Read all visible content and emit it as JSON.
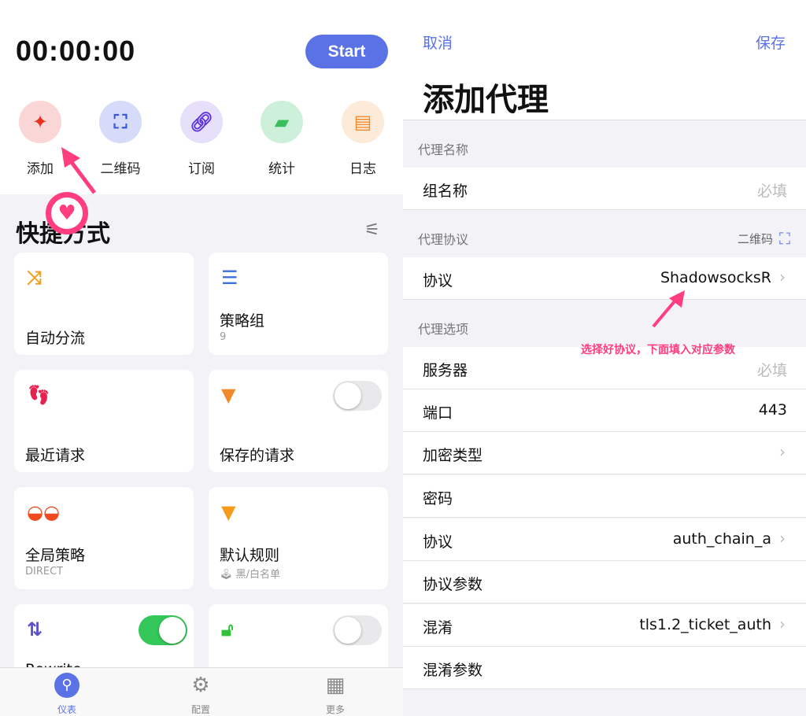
{
  "left": {
    "timer": "00:00:00",
    "start_label": "Start",
    "quick_actions": [
      {
        "label": "添加",
        "icon": "plus-icon",
        "color": "#e8341f",
        "bg": "#fbd6d6"
      },
      {
        "label": "二维码",
        "icon": "qr-scan-icon",
        "color": "#3b55d9",
        "bg": "#d6dbfa"
      },
      {
        "label": "订阅",
        "icon": "link-icon",
        "color": "#5b2fe0",
        "bg": "#e6e0fb"
      },
      {
        "label": "统计",
        "icon": "chart-icon",
        "color": "#3cbf5a",
        "bg": "#ccf0d9"
      },
      {
        "label": "日志",
        "icon": "log-icon",
        "color": "#f08a2a",
        "bg": "#fdebd9"
      }
    ],
    "section_title": "快捷方式",
    "cards": [
      {
        "title": "自动分流",
        "subtitle": "",
        "icon": "shuffle-icon",
        "color": "#f0a020"
      },
      {
        "title": "策略组",
        "subtitle": "9",
        "icon": "list-icon",
        "color": "#3b6fd9"
      },
      {
        "title": "最近请求",
        "subtitle": "",
        "icon": "footprints-icon",
        "color": "#e8204d"
      },
      {
        "title": "保存的请求",
        "subtitle": "",
        "icon": "archive-icon",
        "color": "#f08a2a",
        "toggle": false
      },
      {
        "title": "全局策略",
        "subtitle": "DIRECT",
        "icon": "glasses-icon",
        "color": "#f04a20"
      },
      {
        "title": "默认规则",
        "subtitle": "🕹 黑/白名单",
        "icon": "filter-icon",
        "color": "#f59a1a"
      },
      {
        "title": "Rewrite",
        "subtitle": "",
        "icon": "rewrite-icon",
        "color": "#5b4fd0",
        "toggle": true
      },
      {
        "title": "",
        "subtitle": "",
        "icon": "unlock-icon",
        "color": "#33c03a",
        "toggle": false
      }
    ],
    "tabs": [
      {
        "label": "仪表",
        "active": true
      },
      {
        "label": "配置",
        "active": false
      },
      {
        "label": "更多",
        "active": false
      }
    ]
  },
  "right": {
    "cancel": "取消",
    "save": "保存",
    "title": "添加代理",
    "sec1": "代理名称",
    "group_name_label": "组名称",
    "group_name_placeholder": "必填",
    "sec2": "代理协议",
    "qr_label": "二维码",
    "protocol_label": "协议",
    "protocol_value": "ShadowsocksR",
    "sec3": "代理选项",
    "rows": [
      {
        "label": "服务器",
        "value": "必填",
        "placeholder": true,
        "chevron": false
      },
      {
        "label": "端口",
        "value": "443",
        "chevron": false
      },
      {
        "label": "加密类型",
        "value": "",
        "chevron": true
      },
      {
        "label": "密码",
        "value": "",
        "chevron": false
      },
      {
        "label": "协议",
        "value": "auth_chain_a",
        "chevron": true
      },
      {
        "label": "协议参数",
        "value": "",
        "chevron": false
      },
      {
        "label": "混淆",
        "value": "tls1.2_ticket_auth",
        "chevron": true
      },
      {
        "label": "混淆参数",
        "value": "",
        "chevron": false
      }
    ],
    "annotation": "选择好协议，下面填入对应参数"
  }
}
